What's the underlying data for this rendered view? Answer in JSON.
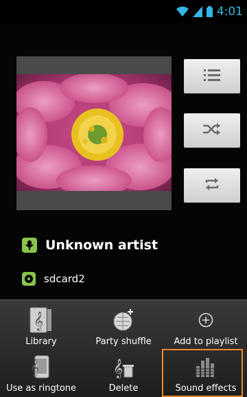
{
  "status_bar": {
    "time": "4:01",
    "icons": [
      "wifi-icon",
      "signal-icon",
      "battery-icon"
    ]
  },
  "now_playing": {
    "artist": "Unknown artist",
    "album": "sdcard2",
    "artist_icon": "microphone-icon",
    "album_icon": "album-icon"
  },
  "side_buttons": [
    "playlist-icon",
    "shuffle-icon",
    "repeat-icon"
  ],
  "menu": {
    "items": [
      {
        "label": "Library",
        "icon": "library-icon"
      },
      {
        "label": "Party shuffle",
        "icon": "party-shuffle-icon"
      },
      {
        "label": "Add to playlist",
        "icon": "add-to-playlist-icon"
      },
      {
        "label": "Use as ringtone",
        "icon": "ringtone-icon"
      },
      {
        "label": "Delete",
        "icon": "delete-icon"
      },
      {
        "label": "Sound effects",
        "icon": "equalizer-icon"
      }
    ]
  },
  "colors": {
    "accent": "#33b5e5",
    "badge": "#8bc34a",
    "highlight": "#f08a24"
  }
}
